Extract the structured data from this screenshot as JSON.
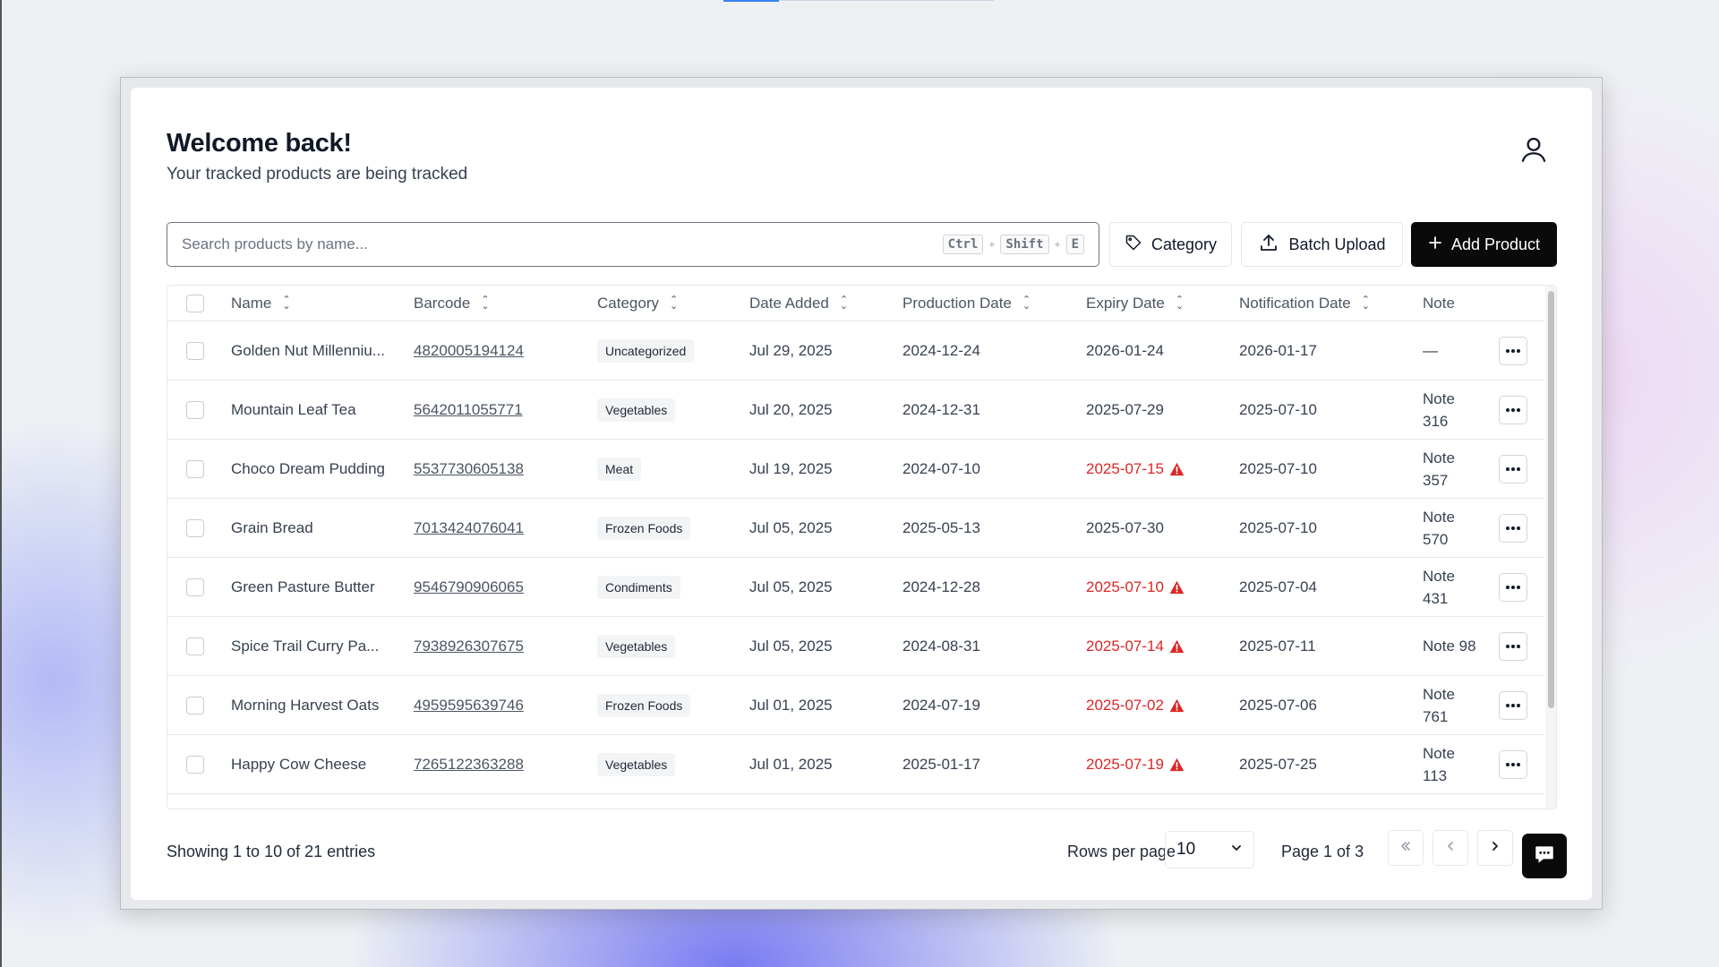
{
  "header": {
    "title": "Welcome back!",
    "subtitle": "Your tracked products are being tracked"
  },
  "search": {
    "placeholder": "Search products by name...",
    "value": "",
    "shortcut": [
      "Ctrl",
      "Shift",
      "E"
    ],
    "plus": "+"
  },
  "toolbar": {
    "category_label": "Category",
    "batch_upload_label": "Batch Upload",
    "add_product_label": "Add Product"
  },
  "table": {
    "columns": [
      "Name",
      "Barcode",
      "Category",
      "Date Added",
      "Production Date",
      "Expiry Date",
      "Notification Date",
      "Note"
    ],
    "rows": [
      {
        "name": "Golden Nut Millenniu...",
        "barcode": "4820005194124",
        "category": "Uncategorized",
        "date_added": "Jul 29, 2025",
        "production_date": "2024-12-24",
        "expiry_date": "2026-01-24",
        "expired": false,
        "notification_date": "2026-01-17",
        "note": "—"
      },
      {
        "name": "Mountain Leaf Tea",
        "barcode": "5642011055771",
        "category": "Vegetables",
        "date_added": "Jul 20, 2025",
        "production_date": "2024-12-31",
        "expiry_date": "2025-07-29",
        "expired": false,
        "notification_date": "2025-07-10",
        "note": "Note 316"
      },
      {
        "name": "Choco Dream Pudding",
        "barcode": "5537730605138",
        "category": "Meat",
        "date_added": "Jul 19, 2025",
        "production_date": "2024-07-10",
        "expiry_date": "2025-07-15",
        "expired": true,
        "notification_date": "2025-07-10",
        "note": "Note 357"
      },
      {
        "name": "Grain Bread",
        "barcode": "7013424076041",
        "category": "Frozen Foods",
        "date_added": "Jul 05, 2025",
        "production_date": "2025-05-13",
        "expiry_date": "2025-07-30",
        "expired": false,
        "notification_date": "2025-07-10",
        "note": "Note 570"
      },
      {
        "name": "Green Pasture Butter",
        "barcode": "9546790906065",
        "category": "Condiments",
        "date_added": "Jul 05, 2025",
        "production_date": "2024-12-28",
        "expiry_date": "2025-07-10",
        "expired": true,
        "notification_date": "2025-07-04",
        "note": "Note 431"
      },
      {
        "name": "Spice Trail Curry Pa...",
        "barcode": "7938926307675",
        "category": "Vegetables",
        "date_added": "Jul 05, 2025",
        "production_date": "2024-08-31",
        "expiry_date": "2025-07-14",
        "expired": true,
        "notification_date": "2025-07-11",
        "note": "Note 98"
      },
      {
        "name": "Morning Harvest Oats",
        "barcode": "4959595639746",
        "category": "Frozen Foods",
        "date_added": "Jul 01, 2025",
        "production_date": "2024-07-19",
        "expiry_date": "2025-07-02",
        "expired": true,
        "notification_date": "2025-07-06",
        "note": "Note 761"
      },
      {
        "name": "Happy Cow Cheese",
        "barcode": "7265122363288",
        "category": "Vegetables",
        "date_added": "Jul 01, 2025",
        "production_date": "2025-01-17",
        "expiry_date": "2025-07-19",
        "expired": true,
        "notification_date": "2025-07-25",
        "note": "Note 113"
      }
    ]
  },
  "footer": {
    "showing": "Showing 1 to 10 of 21 entries",
    "rows_per_page_label": "Rows per page",
    "rows_per_page_value": "10",
    "page_label": "Page 1 of 3"
  },
  "colors": {
    "accent": "#0a0a0a",
    "expired": "#dc2626"
  },
  "icons": {
    "user": "user-icon",
    "tag": "tag-icon",
    "upload": "upload-icon",
    "plus": "plus-icon",
    "warning": "warning-icon",
    "more": "more-horizontal-icon",
    "chat": "chat-icon"
  }
}
